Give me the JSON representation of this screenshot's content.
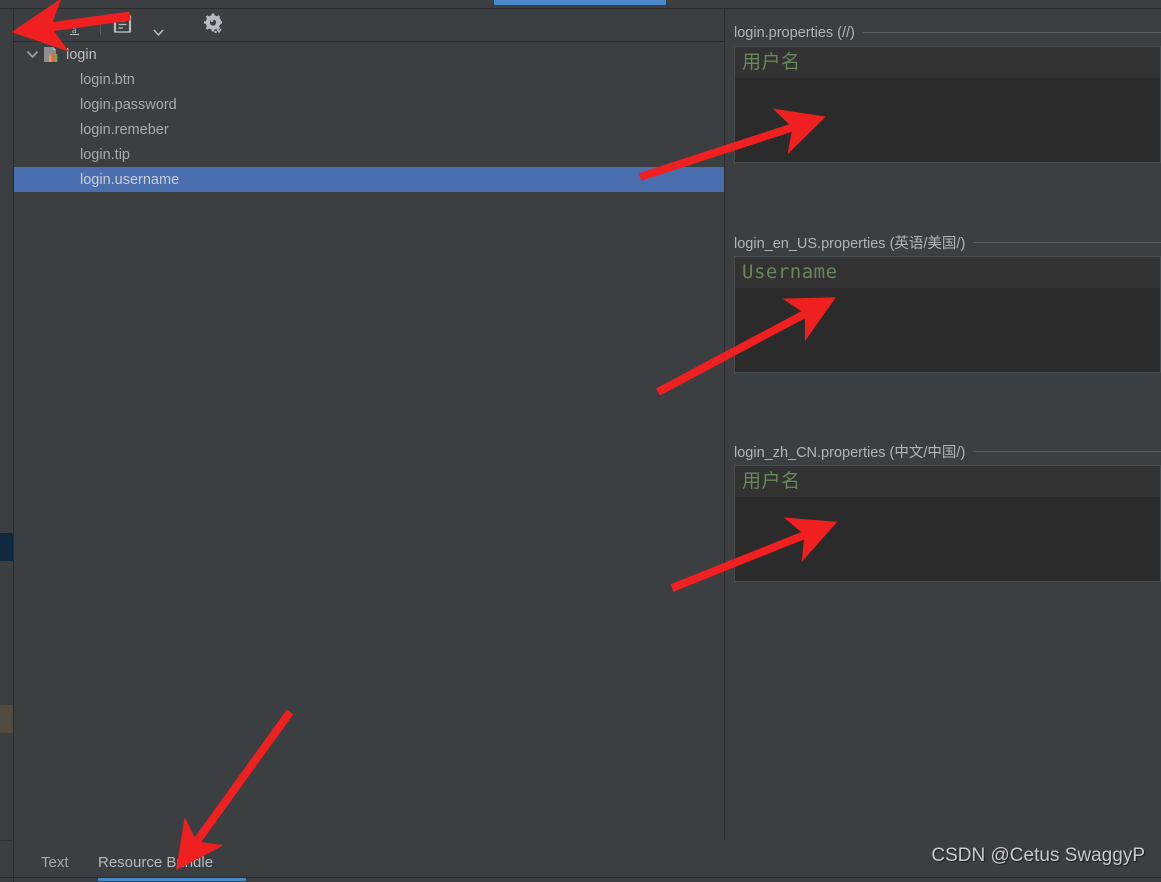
{
  "window": {
    "active_tab_indicator": true,
    "accent_color": "#4a88c7",
    "background_color": "#3c3f41",
    "editor_background": "#2b2b2b",
    "selection_color": "#4b6eaf",
    "string_value_color": "#6a8759",
    "annotation_arrow_color": "#f02020"
  },
  "toolbar": {
    "add_label": "+",
    "add_name": "add-property",
    "new_property_label": "ab",
    "new_bundle_label": "new-bundle",
    "dropdown_label": "▾",
    "settings_label": "settings",
    "help_label": "?"
  },
  "tree": {
    "root": {
      "label": "login",
      "expanded": true,
      "icon": "resource-bundle-icon"
    },
    "children": [
      {
        "label": "login.btn",
        "selected": false
      },
      {
        "label": "login.password",
        "selected": false
      },
      {
        "label": "login.remeber",
        "selected": false
      },
      {
        "label": "login.tip",
        "selected": false
      },
      {
        "label": "login.username",
        "selected": true
      }
    ]
  },
  "editor_sections": [
    {
      "title": "login.properties (//)",
      "value": "用户名",
      "font": "cjk"
    },
    {
      "title": "login_en_US.properties (英语/美国/)",
      "value": "Username",
      "font": "mono"
    },
    {
      "title": "login_zh_CN.properties (中文/中国/)",
      "value": "用户名",
      "font": "cjk"
    }
  ],
  "bottom_tabs": {
    "tabs": [
      {
        "label": "Text",
        "active": false
      },
      {
        "label": "Resource Bundle",
        "active": true
      }
    ]
  },
  "watermark": {
    "text": "CSDN @Cetus SwaggyP"
  },
  "left_stripe_marks": [
    {
      "name": "stripe-mark-blue",
      "color": "#0e2940"
    },
    {
      "name": "stripe-mark-olive",
      "color": "#4f4b3e"
    }
  ]
}
